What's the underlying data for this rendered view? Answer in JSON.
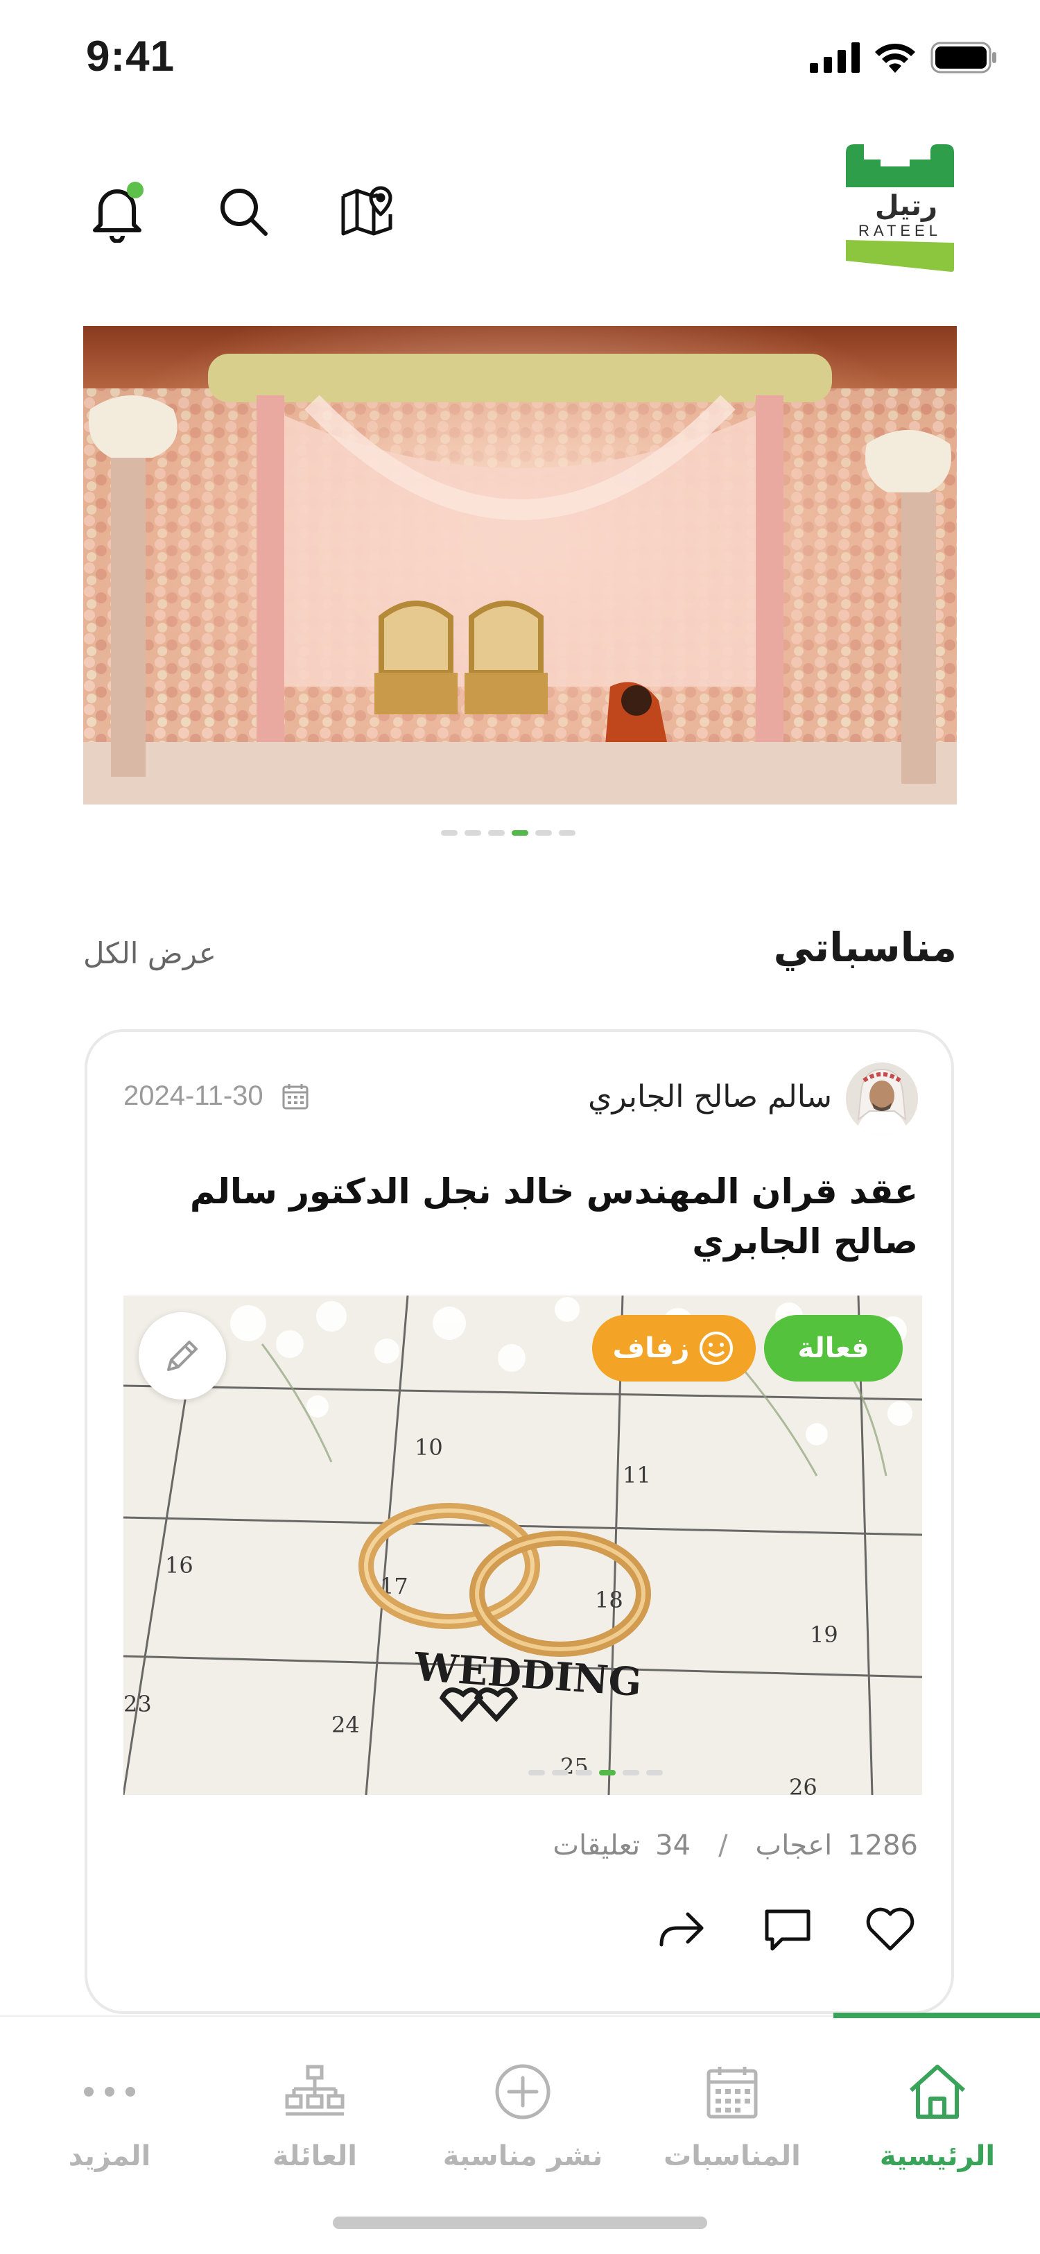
{
  "status_bar": {
    "time": "9:41"
  },
  "header": {
    "logo": {
      "text_ar": "رتيل",
      "text_en": "RATEEL"
    },
    "icons": [
      "map-pin-icon",
      "search-icon",
      "bell-icon"
    ],
    "notification_dot_color": "#5cc04a"
  },
  "hero": {
    "slides": 6,
    "active_slide": 4
  },
  "section": {
    "title": "مناسباتي",
    "view_all": "عرض الكل"
  },
  "event_card": {
    "author": "سالم صالح الجابري",
    "date": "2024-11-30",
    "title": "عقد قران المهندس خالد نجل الدكتور سالم صالح الجابري",
    "badges": {
      "status": "فعالة",
      "type": "زفاف"
    },
    "image_text": "WEDDING",
    "image": {
      "slides": 6,
      "active_slide": 4
    },
    "likes_count": "1286",
    "likes_label": "اعجاب",
    "separator": "/",
    "comments_count": "34",
    "comments_label": "تعليقات"
  },
  "bottom_nav": {
    "items": [
      {
        "label": "الرئيسية",
        "icon": "home-icon",
        "active": true
      },
      {
        "label": "المناسبات",
        "icon": "calendar-icon",
        "active": false
      },
      {
        "label": "نشر مناسبة",
        "icon": "plus-circle-icon",
        "active": false
      },
      {
        "label": "العائلة",
        "icon": "family-tree-icon",
        "active": false
      },
      {
        "label": "المزيد",
        "icon": "more-dots-icon",
        "active": false
      }
    ]
  },
  "colors": {
    "accent_green": "#3aa35a",
    "badge_green": "#55c23e",
    "badge_orange": "#f3a325"
  }
}
